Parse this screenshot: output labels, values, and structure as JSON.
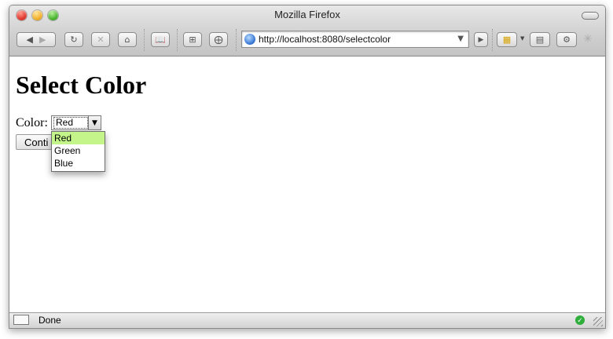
{
  "window": {
    "title": "Mozilla Firefox"
  },
  "toolbar": {
    "url": "http://localhost:8080/selectcolor",
    "buttons": [
      {
        "name": "back",
        "icon": "back-icon"
      },
      {
        "name": "forward",
        "icon": "forward-icon"
      },
      {
        "name": "reload",
        "icon": "reload-icon"
      },
      {
        "name": "stop",
        "icon": "stop-icon"
      },
      {
        "name": "home",
        "icon": "home-icon"
      },
      {
        "name": "bookmarks",
        "icon": "bookmarks-icon"
      },
      {
        "name": "add-bookmark",
        "icon": "plus-icon"
      },
      {
        "name": "new-tab",
        "icon": "new-tab-icon"
      },
      {
        "name": "go",
        "icon": "go-icon"
      },
      {
        "name": "downloads",
        "icon": "downloads-icon"
      },
      {
        "name": "window",
        "icon": "window-icon"
      },
      {
        "name": "settings",
        "icon": "gear-icon"
      }
    ]
  },
  "page": {
    "heading": "Select Color",
    "color_label": "Color:",
    "select_value": "Red",
    "options": [
      "Red",
      "Green",
      "Blue"
    ],
    "selected_index": 0,
    "continue_label": "Conti"
  },
  "status": {
    "text": "Done"
  },
  "colors": {
    "selected_option_bg": "#c4f58a",
    "status_ok": "#2eae3a"
  }
}
